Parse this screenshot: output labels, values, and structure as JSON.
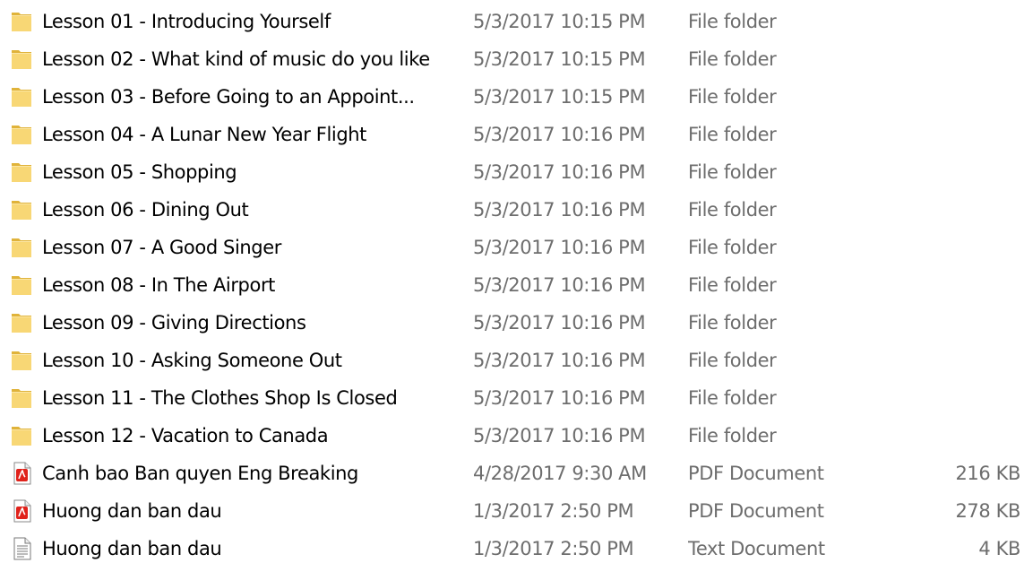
{
  "rows": [
    {
      "name": "Lesson 01 - Introducing Yourself",
      "date": "5/3/2017 10:15 PM",
      "type": "File folder",
      "size": "",
      "icon": "folder-icon"
    },
    {
      "name": "Lesson 02 - What kind of music do you like",
      "date": "5/3/2017 10:15 PM",
      "type": "File folder",
      "size": "",
      "icon": "folder-icon"
    },
    {
      "name": "Lesson 03 - Before Going to an Appoint...",
      "date": "5/3/2017 10:15 PM",
      "type": "File folder",
      "size": "",
      "icon": "folder-icon"
    },
    {
      "name": "Lesson 04 - A Lunar New Year Flight",
      "date": "5/3/2017 10:16 PM",
      "type": "File folder",
      "size": "",
      "icon": "folder-icon"
    },
    {
      "name": "Lesson 05 - Shopping",
      "date": "5/3/2017 10:16 PM",
      "type": "File folder",
      "size": "",
      "icon": "folder-icon"
    },
    {
      "name": "Lesson 06 - Dining Out",
      "date": "5/3/2017 10:16 PM",
      "type": "File folder",
      "size": "",
      "icon": "folder-icon"
    },
    {
      "name": "Lesson 07 - A Good Singer",
      "date": "5/3/2017 10:16 PM",
      "type": "File folder",
      "size": "",
      "icon": "folder-icon"
    },
    {
      "name": "Lesson 08 - In The Airport",
      "date": "5/3/2017 10:16 PM",
      "type": "File folder",
      "size": "",
      "icon": "folder-icon"
    },
    {
      "name": "Lesson 09 - Giving Directions",
      "date": "5/3/2017 10:16 PM",
      "type": "File folder",
      "size": "",
      "icon": "folder-icon"
    },
    {
      "name": "Lesson 10 - Asking Someone Out",
      "date": "5/3/2017 10:16 PM",
      "type": "File folder",
      "size": "",
      "icon": "folder-icon"
    },
    {
      "name": "Lesson 11 - The Clothes Shop Is Closed",
      "date": "5/3/2017 10:16 PM",
      "type": "File folder",
      "size": "",
      "icon": "folder-icon"
    },
    {
      "name": "Lesson 12 - Vacation to Canada",
      "date": "5/3/2017 10:16 PM",
      "type": "File folder",
      "size": "",
      "icon": "folder-icon"
    },
    {
      "name": "Canh bao Ban quyen Eng Breaking",
      "date": "4/28/2017 9:30 AM",
      "type": "PDF Document",
      "size": "216 KB",
      "icon": "pdf-file-icon"
    },
    {
      "name": "Huong dan ban dau",
      "date": "1/3/2017 2:50 PM",
      "type": "PDF Document",
      "size": "278 KB",
      "icon": "pdf-file-icon"
    },
    {
      "name": "Huong dan ban dau",
      "date": "1/3/2017 2:50 PM",
      "type": "Text Document",
      "size": "4 KB",
      "icon": "text-file-icon"
    }
  ],
  "colors": {
    "folder": "#f8d775",
    "folder_dark": "#e0b33a",
    "pdf_red": "#e0221b",
    "meta_text": "#6d6d6d"
  }
}
